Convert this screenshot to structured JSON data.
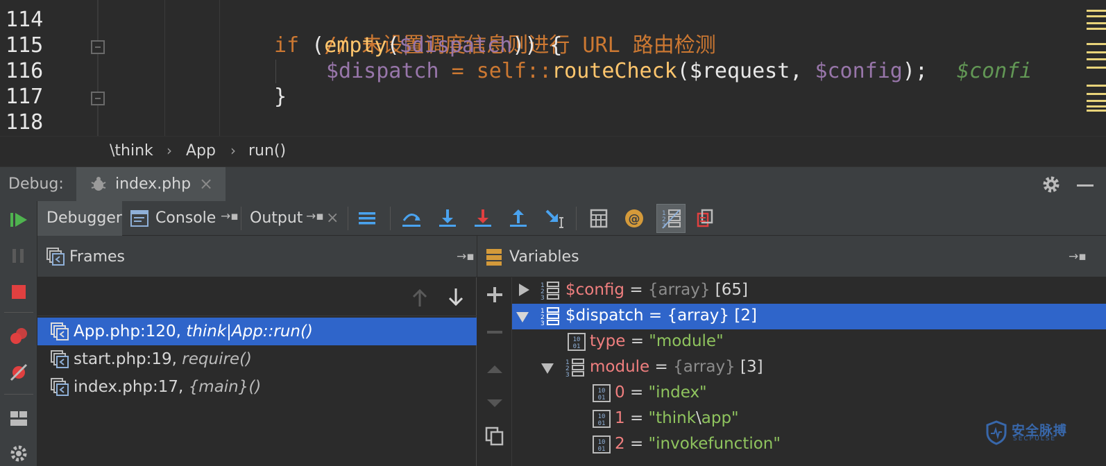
{
  "editor": {
    "line_numbers": [
      "114",
      "115",
      "116",
      "117",
      "118"
    ],
    "lines": {
      "l114_comment": "// 未设置调度信息则进行 URL 路由检测",
      "l115_if": "if",
      "l115_open": " (",
      "l115_empty": "empty",
      "l115_paren": "(",
      "l115_var": "$dispatch",
      "l115_close": ")) {",
      "l116_var": "$dispatch",
      "l116_eq": " = ",
      "l116_self": "self::",
      "l116_fn": "routeCheck",
      "l116_p1": "(",
      "l116_arg1": "$request",
      "l116_comma": ", ",
      "l116_arg2": "$config",
      "l116_end": ");",
      "l116_inline": "$confi",
      "l117_brace": "}"
    }
  },
  "breadcrumb": {
    "items": [
      "\\think",
      "App",
      "run()"
    ],
    "separator": "›"
  },
  "debug": {
    "label": "Debug:",
    "tab_label": "index.php",
    "tab_close": "×"
  },
  "tabs": {
    "debugger": "Debugger",
    "console": "Console",
    "output": "Output",
    "pin": "→▪",
    "close": "×"
  },
  "frames": {
    "title": "Frames",
    "pin": "→▪",
    "items": [
      {
        "location": "App.php:120, ",
        "func": "think|App::run()"
      },
      {
        "location": "start.php:19, ",
        "func": "require()"
      },
      {
        "location": "index.php:17, ",
        "func": "{main}()"
      }
    ]
  },
  "variables": {
    "title": "Variables",
    "pin": "→▪",
    "rows": [
      {
        "name": "$config",
        "eq": " = ",
        "type": "{array}",
        "count": " [65]"
      },
      {
        "name": "$dispatch",
        "eq": " = ",
        "type": "{array}",
        "count": " [2]"
      },
      {
        "name": "type",
        "eq": " = ",
        "value": "\"module\""
      },
      {
        "name": "module",
        "eq": " = ",
        "type": "{array}",
        "count": " [3]"
      },
      {
        "name": "0",
        "eq": " = ",
        "value": "\"index\""
      },
      {
        "name": "1",
        "eq": " = ",
        "value_a": "\"think",
        "value_esc": "\\",
        "value_b": "app\""
      },
      {
        "name": "2",
        "eq": " = ",
        "value": "\"invokefunction\""
      }
    ]
  },
  "watermark": {
    "cn": "安全脉搏",
    "en": "SECPULSE"
  },
  "colors": {
    "selection": "#2f65ca",
    "panel_bg": "#3c3f41",
    "editor_bg": "#2b2b2b",
    "keyword": "#cc7832",
    "function": "#ffc66d",
    "variable": "#9876aa",
    "string": "#8fc45e",
    "var_name": "#f07f7f"
  }
}
